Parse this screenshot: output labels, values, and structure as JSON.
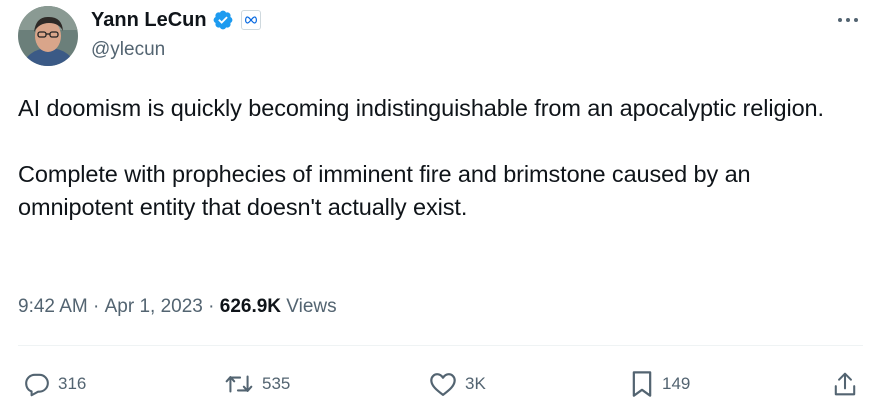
{
  "author": {
    "display_name": "Yann LeCun",
    "handle": "@ylecun",
    "avatar": "avatar-photo",
    "verified_icon": "verified-badge-icon",
    "affiliate_icon": "meta-infinity-icon"
  },
  "more_icon": "more-icon",
  "tweet": {
    "paragraphs": [
      "AI doomism is quickly becoming indistinguishable from an apocalyptic religion.",
      "Complete with prophecies of imminent fire and brimstone caused by an omnipotent entity that doesn't actually exist."
    ]
  },
  "meta": {
    "time": "9:42 AM",
    "separator": " · ",
    "date": "Apr 1, 2023",
    "views_count": "626.9K",
    "views_label": " Views"
  },
  "actions": {
    "reply": {
      "icon": "reply-icon",
      "count": "316"
    },
    "retweet": {
      "icon": "retweet-icon",
      "count": "535"
    },
    "like": {
      "icon": "heart-icon",
      "count": "3K"
    },
    "bookmark": {
      "icon": "bookmark-icon",
      "count": "149"
    },
    "share": {
      "icon": "share-icon"
    }
  },
  "colors": {
    "text": "#0f1419",
    "secondary": "#536471",
    "verified": "#1d9bf0",
    "divider": "#eff3f4"
  }
}
